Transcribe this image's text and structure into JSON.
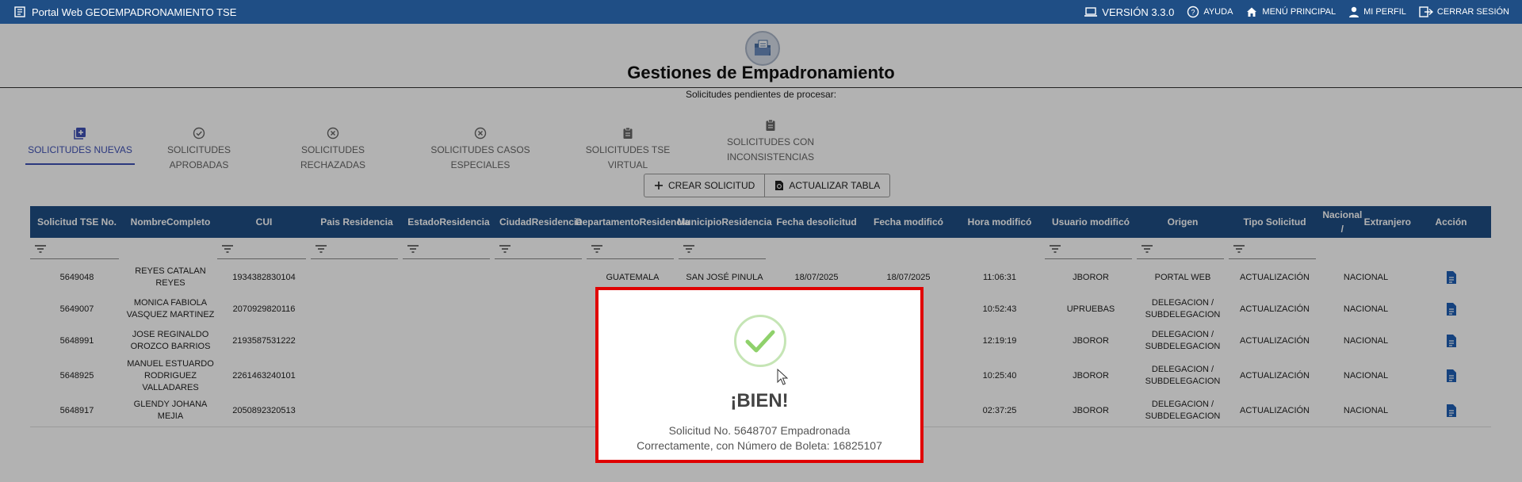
{
  "topbar": {
    "title": "Portal Web GEOEMPADRONAMIENTO TSE",
    "version": "VERSIÓN 3.3.0",
    "links": [
      "AYUDA",
      "MENÚ PRINCIPAL",
      "MI PERFIL",
      "CERRAR SESIÓN"
    ]
  },
  "page": {
    "title": "Gestiones de Empadronamiento",
    "subtitle": "Solicitudes pendientes de procesar:"
  },
  "tabs": [
    {
      "label": "SOLICITUDES NUEVAS",
      "icon": "add-box-icon",
      "active": true
    },
    {
      "label": "SOLICITUDES APROBADAS",
      "icon": "check-circle-icon"
    },
    {
      "label": "SOLICITUDES RECHAZADAS",
      "icon": "cancel-circle-icon"
    },
    {
      "label": "SOLICITUDES CASOS ESPECIALES",
      "icon": "cancel-circle-icon"
    },
    {
      "label": "SOLICITUDES TSE VIRTUAL",
      "icon": "clipboard-icon"
    },
    {
      "label_line1": "SOLICITUDES CON",
      "label_line2": "INCONSISTENCIAS",
      "icon": "clipboard-icon"
    }
  ],
  "actions": {
    "create": "CREAR SOLICITUD",
    "refresh": "ACTUALIZAR TABLA"
  },
  "table": {
    "headers": [
      [
        "Solicitud TSE No."
      ],
      [
        "Nombre",
        "Completo"
      ],
      [
        "CUI"
      ],
      [
        "Pais Residencia"
      ],
      [
        "Estado",
        "Residencia"
      ],
      [
        "Ciudad",
        "Residencia"
      ],
      [
        "Departamento",
        "Residencia"
      ],
      [
        "Municipio",
        "Residencia"
      ],
      [
        "Fecha de",
        "solicitud"
      ],
      [
        "Fecha modificó"
      ],
      [
        "Hora modificó"
      ],
      [
        "Usuario modificó"
      ],
      [
        "Origen"
      ],
      [
        "Tipo Solicitud"
      ],
      [
        "Nacional /",
        "Extranjero"
      ],
      [
        "Acción"
      ]
    ],
    "rows": [
      {
        "id": "5649048",
        "name": [
          "REYES CATALAN REYES"
        ],
        "cui": "1934382830104",
        "depto": "GUATEMALA",
        "muni": "SAN JOSÉ PINULA",
        "fecha_sol": "18/07/2025",
        "fecha_mod": "18/07/2025",
        "hora": "11:06:31",
        "usuario": "JBOROR",
        "origen": [
          "PORTAL WEB"
        ],
        "tipo": "ACTUALIZACIÓN",
        "nac": "NACIONAL"
      },
      {
        "id": "5649007",
        "name": [
          "MONICA FABIOLA",
          "VASQUEZ MARTINEZ"
        ],
        "cui": "2070929820116",
        "depto": "",
        "muni": "",
        "fecha_sol": "",
        "fecha_mod": "",
        "hora": "10:52:43",
        "usuario": "UPRUEBAS",
        "origen": [
          "DELEGACION /",
          "SUBDELEGACION"
        ],
        "tipo": "ACTUALIZACIÓN",
        "nac": "NACIONAL"
      },
      {
        "id": "5648991",
        "name": [
          "JOSE REGINALDO",
          "OROZCO BARRIOS"
        ],
        "cui": "2193587531222",
        "depto": "",
        "muni": "",
        "fecha_sol": "",
        "fecha_mod": "",
        "hora": "12:19:19",
        "usuario": "JBOROR",
        "origen": [
          "DELEGACION /",
          "SUBDELEGACION"
        ],
        "tipo": "ACTUALIZACIÓN",
        "nac": "NACIONAL"
      },
      {
        "id": "5648925",
        "name": [
          "MANUEL ESTUARDO",
          "RODRIGUEZ",
          "VALLADARES"
        ],
        "cui": "2261463240101",
        "depto": "",
        "muni": "",
        "fecha_sol": "",
        "fecha_mod": "",
        "hora": "10:25:40",
        "usuario": "JBOROR",
        "origen": [
          "DELEGACION /",
          "SUBDELEGACION"
        ],
        "tipo": "ACTUALIZACIÓN",
        "nac": "NACIONAL"
      },
      {
        "id": "5648917",
        "name": [
          "GLENDY JOHANA",
          "MEJIA"
        ],
        "cui": "2050892320513",
        "depto": "",
        "muni": "",
        "fecha_sol": "",
        "fecha_mod": "",
        "hora": "02:37:25",
        "usuario": "JBOROR",
        "origen": [
          "DELEGACION /",
          "SUBDELEGACION"
        ],
        "tipo": "ACTUALIZACIÓN",
        "nac": "NACIONAL"
      }
    ]
  },
  "modal": {
    "title": "¡BIEN!",
    "line1": "Solicitud No. 5648707 Empadronada",
    "line2": "Correctamente, con Número de Boleta: 16825107"
  },
  "colors": {
    "primary": "#1f4e85",
    "active_tab": "#3f51b5",
    "modal_border": "#e00000",
    "success": "#8fd16b"
  }
}
